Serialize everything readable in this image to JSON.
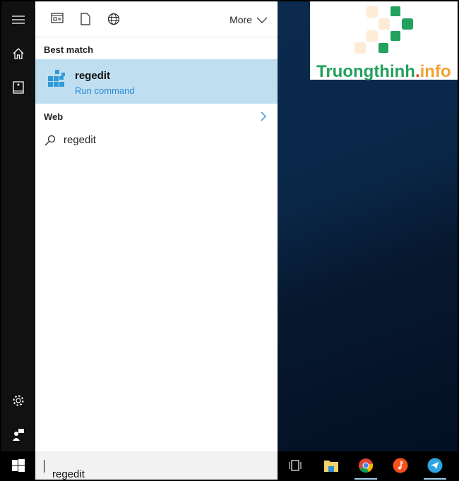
{
  "topbar": {
    "filters": [
      "apps-filter",
      "documents-filter",
      "web-filter"
    ],
    "more_label": "More"
  },
  "best_match": {
    "header": "Best match",
    "title": "regedit",
    "subtitle": "Run command"
  },
  "web": {
    "header": "Web",
    "item": "regedit"
  },
  "search": {
    "value": "regedit"
  },
  "logo": {
    "name": "Truongthinh",
    "dot": ".",
    "suffix": "info"
  },
  "colors": {
    "highlight": "#bfdff0",
    "accent": "#2b8ad4",
    "logo_green": "#22a15f",
    "logo_orange": "#f0a131"
  },
  "taskbar": {
    "apps": [
      "task-view",
      "file-explorer",
      "chrome",
      "music",
      "telegram"
    ]
  }
}
